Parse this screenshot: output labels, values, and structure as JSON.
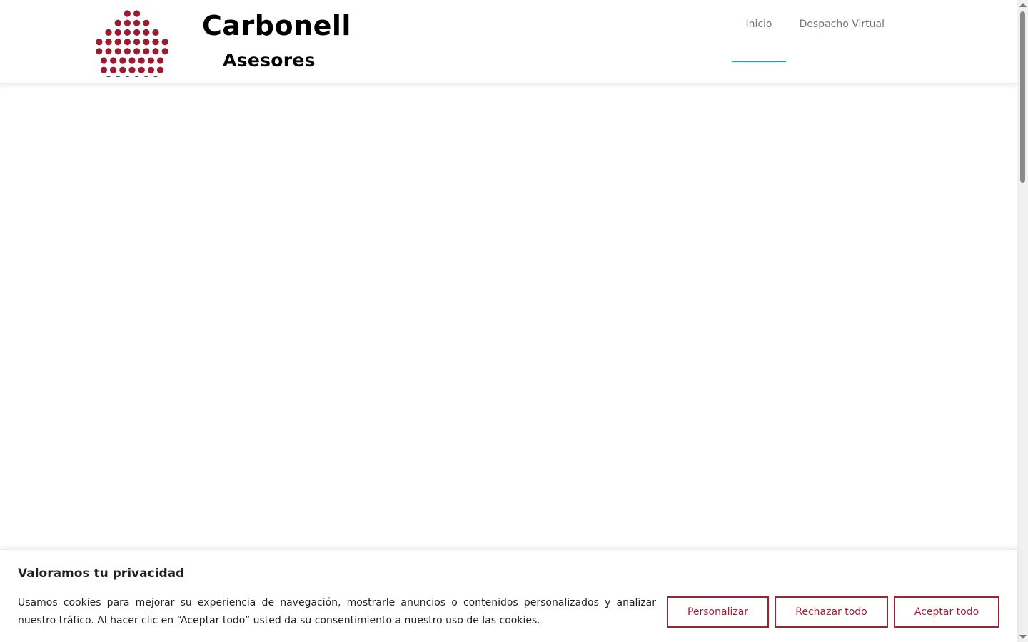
{
  "header": {
    "brand_name": "Carbonell",
    "brand_sub": "Asesores",
    "logo_color": "#9b1b30",
    "nav": [
      {
        "label": "Inicio",
        "active": true
      },
      {
        "label": "Despacho Virtual",
        "active": false
      }
    ],
    "nav_active_color": "#2a9bb5"
  },
  "cookie_banner": {
    "title": "Valoramos tu privacidad",
    "text": "Usamos cookies para mejorar su experiencia de navegación, mostrarle anuncios o contenidos personalizados y analizar nuestro tráfico. Al hacer clic en “Aceptar todo” usted da su consentimiento a nuestro uso de las cookies.",
    "buttons": {
      "customize": "Personalizar",
      "reject": "Rechazar todo",
      "accept": "Aceptar todo"
    },
    "button_color": "#9b2335"
  }
}
